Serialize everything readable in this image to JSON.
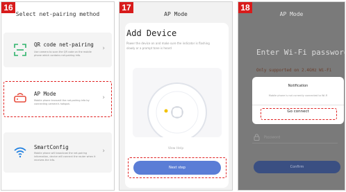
{
  "panels": {
    "p16": {
      "step": "16",
      "header": "Select net-pairing method",
      "options": [
        {
          "title": "QR code net-pairing",
          "desc": "Use camera to scan the QR code on the mobile phone which contains net-pairing info.",
          "icon": "qr-scan-icon"
        },
        {
          "title": "AP Mode",
          "desc": "Mobile phone transmit the net-pairing info by connecting camera's hotspot.",
          "icon": "router-icon"
        },
        {
          "title": "SmartConfig",
          "desc": "Mobile phone will broadcast the net-pairing information, device will connect the router when it receives the info.",
          "icon": "wifi-icon"
        }
      ],
      "chevron": "›"
    },
    "p17": {
      "step": "17",
      "header": "AP Mode",
      "title": "Add Device",
      "desc": "Power the device on and make sure the indicator is flashing slowly or a prompt tone is heard",
      "view_help": "View Help",
      "next_step": "Next step"
    },
    "p18": {
      "step": "18",
      "header": "AP Mode",
      "title": "Enter Wi-Fi password",
      "note": "Only supported on 2.4GHz Wi-Fi",
      "dialog": {
        "title": "Notification",
        "message": "Mobile phone is not currently connected to Wi-Fi",
        "button": "Go connect"
      },
      "password_placeholder": "Password",
      "confirm": "Confirm"
    }
  },
  "colors": {
    "accent_red": "#e02020",
    "badge_red": "#d81b1b",
    "blue_button": "#5a7dd6",
    "green_icon": "#2fb36b",
    "red_icon": "#e74c3c",
    "blue_icon": "#1e7fe0"
  }
}
